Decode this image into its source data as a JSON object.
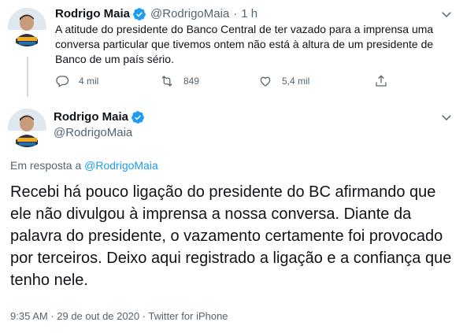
{
  "reply_tweet": {
    "display_name": "Rodrigo Maia",
    "handle": "@RodrigoMaia",
    "separator": "·",
    "time": "1 h",
    "text": "A atitude do presidente do Banco Central de ter vazado para a imprensa uma conversa particular que tivemos ontem não está à altura de um presidente de Banco de um país sério.",
    "actions": {
      "replies": "4 mil",
      "retweets": "849",
      "likes": "5,4 mil"
    },
    "icons": [
      "reply-icon",
      "retweet-icon",
      "like-icon",
      "share-icon",
      "more-caret-icon",
      "verified-icon"
    ]
  },
  "main_tweet": {
    "display_name": "Rodrigo Maia",
    "handle": "@RodrigoMaia",
    "reply_prefix": "Em resposta a",
    "reply_mention": "@RodrigoMaia",
    "text": "Recebi há pouco ligação do presidente do BC afirmando que ele não divulgou à imprensa a nossa conversa. Diante da palavra do presidente, o vazamento certamente foi provocado por terceiros. Deixo aqui registrado a ligação e a confiança que tenho nele.",
    "meta": "9:35 AM · 29 de out de 2020 · Twitter for iPhone"
  },
  "colors": {
    "text": "#0f1419",
    "secondary": "#536471",
    "accent": "#1d9bf0",
    "thread_line": "#cfd9de"
  }
}
